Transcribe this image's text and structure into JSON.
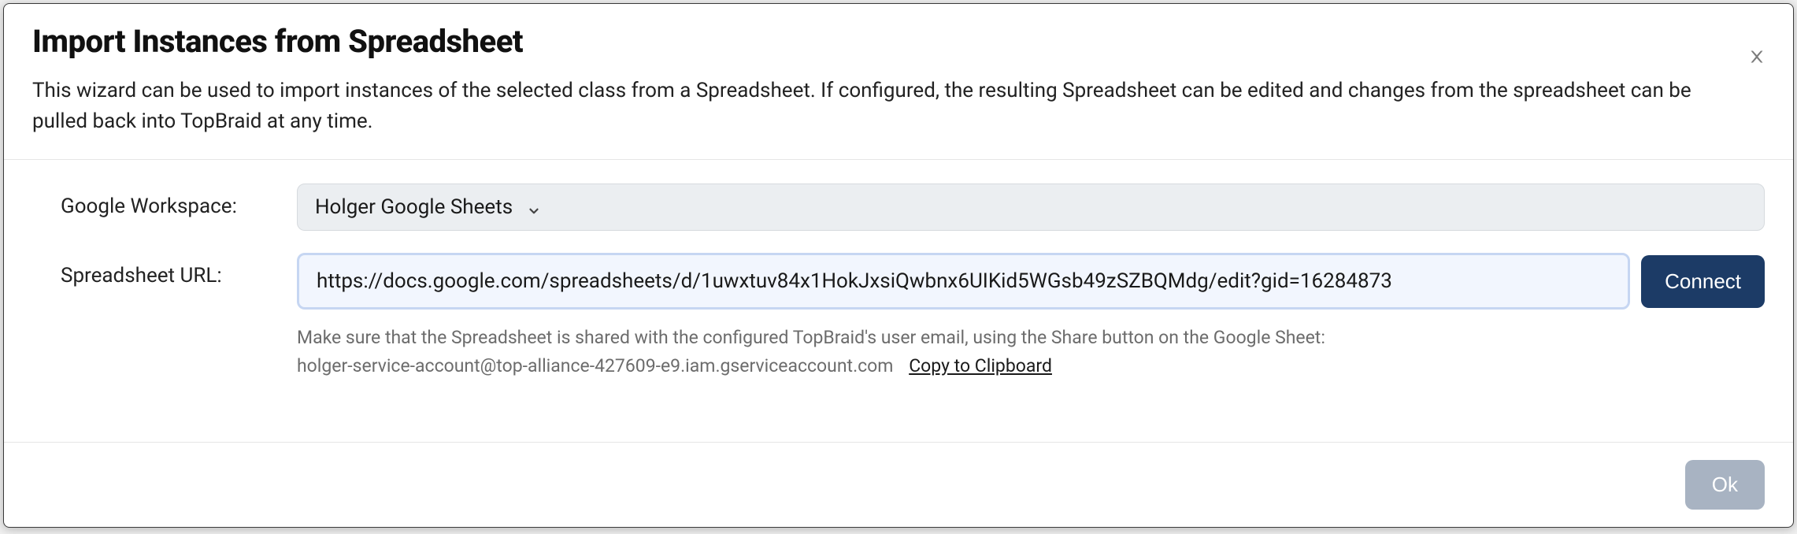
{
  "dialog": {
    "title": "Import Instances from Spreadsheet",
    "subtitle": "This wizard can be used to import instances of the selected class from a Spreadsheet. If configured, the resulting Spreadsheet can be edited and changes from the spreadsheet can be pulled back into TopBraid at any time."
  },
  "form": {
    "workspace_label": "Google Workspace:",
    "workspace_selected": "Holger Google Sheets",
    "url_label": "Spreadsheet URL:",
    "url_value": "https://docs.google.com/spreadsheets/d/1uwxtuv84x1HokJxsiQwbnx6UIKid5WGsb49zSZBQMdg/edit?gid=16284873",
    "connect_label": "Connect",
    "hint_text": "Make sure that the Spreadsheet is shared with the configured TopBraid's user email, using the Share button on the Google Sheet:",
    "service_email": "holger-service-account@top-alliance-427609-e9.iam.gserviceaccount.com",
    "copy_label": "Copy to Clipboard"
  },
  "footer": {
    "ok_label": "Ok"
  }
}
